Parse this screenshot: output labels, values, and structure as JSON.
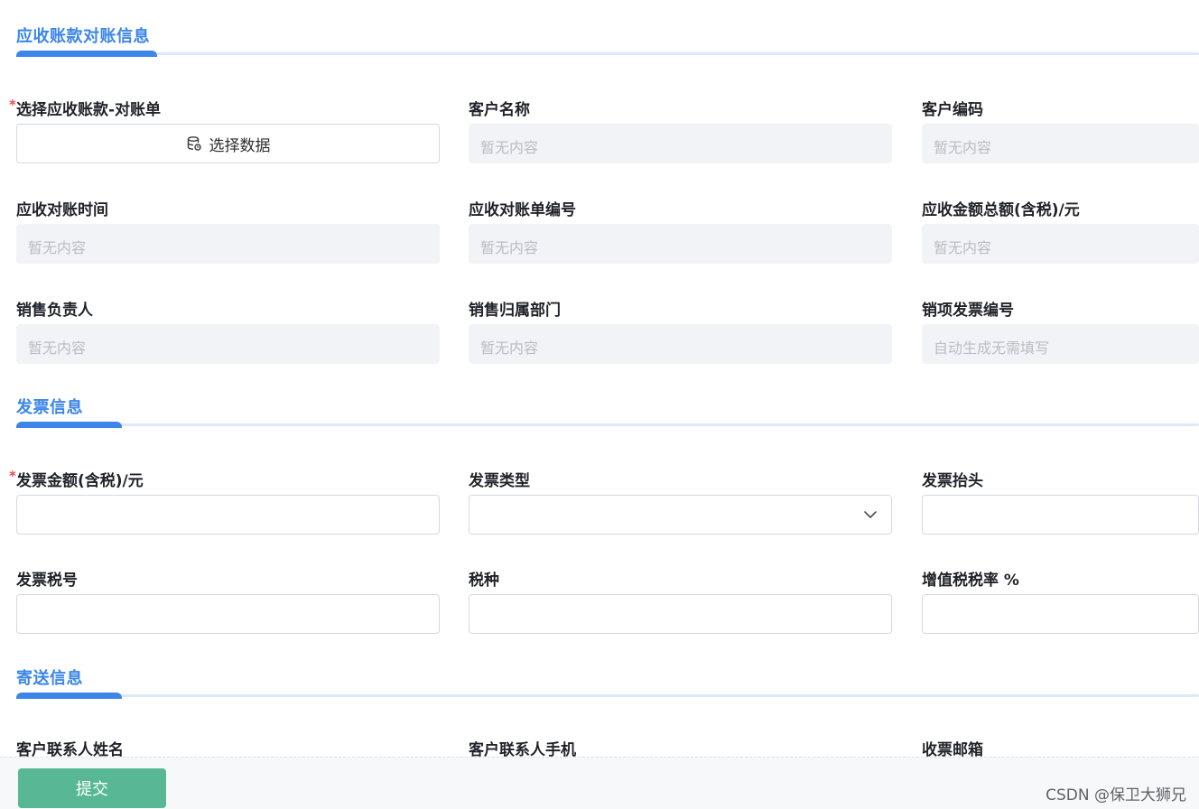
{
  "sections": {
    "reconciliation": {
      "title": "应收账款对账信息",
      "fields": {
        "select_bill": {
          "label": "选择应收账款-对账单",
          "required_mark": "*",
          "button_label": "选择数据"
        },
        "customer_name": {
          "label": "客户名称",
          "placeholder": "暂无内容"
        },
        "customer_code": {
          "label": "客户编码",
          "placeholder": "暂无内容"
        },
        "reconcile_time": {
          "label": "应收对账时间",
          "placeholder": "暂无内容"
        },
        "reconcile_no": {
          "label": "应收对账单编号",
          "placeholder": "暂无内容"
        },
        "total_amount": {
          "label": "应收金额总额(含税)/元",
          "placeholder": "暂无内容"
        },
        "sales_owner": {
          "label": "销售负责人",
          "placeholder": "暂无内容"
        },
        "sales_dept": {
          "label": "销售归属部门",
          "placeholder": "暂无内容"
        },
        "invoice_no": {
          "label": "销项发票编号",
          "placeholder": "自动生成无需填写"
        }
      }
    },
    "invoice": {
      "title": "发票信息",
      "fields": {
        "amount": {
          "label": "发票金额(含税)/元",
          "required_mark": "*",
          "value": ""
        },
        "type": {
          "label": "发票类型",
          "value": ""
        },
        "header": {
          "label": "发票抬头",
          "value": ""
        },
        "tax_no": {
          "label": "发票税号",
          "value": ""
        },
        "tax_kind": {
          "label": "税种",
          "value": ""
        },
        "vat_rate": {
          "label": "增值税税率 %",
          "value": ""
        }
      }
    },
    "delivery": {
      "title": "寄送信息",
      "fields": {
        "contact_name": {
          "label": "客户联系人姓名"
        },
        "contact_phone": {
          "label": "客户联系人手机"
        },
        "email": {
          "label": "收票邮箱"
        }
      }
    }
  },
  "footer": {
    "submit_label": "提交"
  },
  "watermark": "CSDN @保卫大狮兄",
  "colors": {
    "accent": "#3b86e8",
    "submit": "#58b895",
    "required": "#e34d59",
    "disabled_bg": "#f1f3f6"
  },
  "icons": {
    "select_button": "database-icon",
    "type_select": "chevron-down-icon"
  }
}
